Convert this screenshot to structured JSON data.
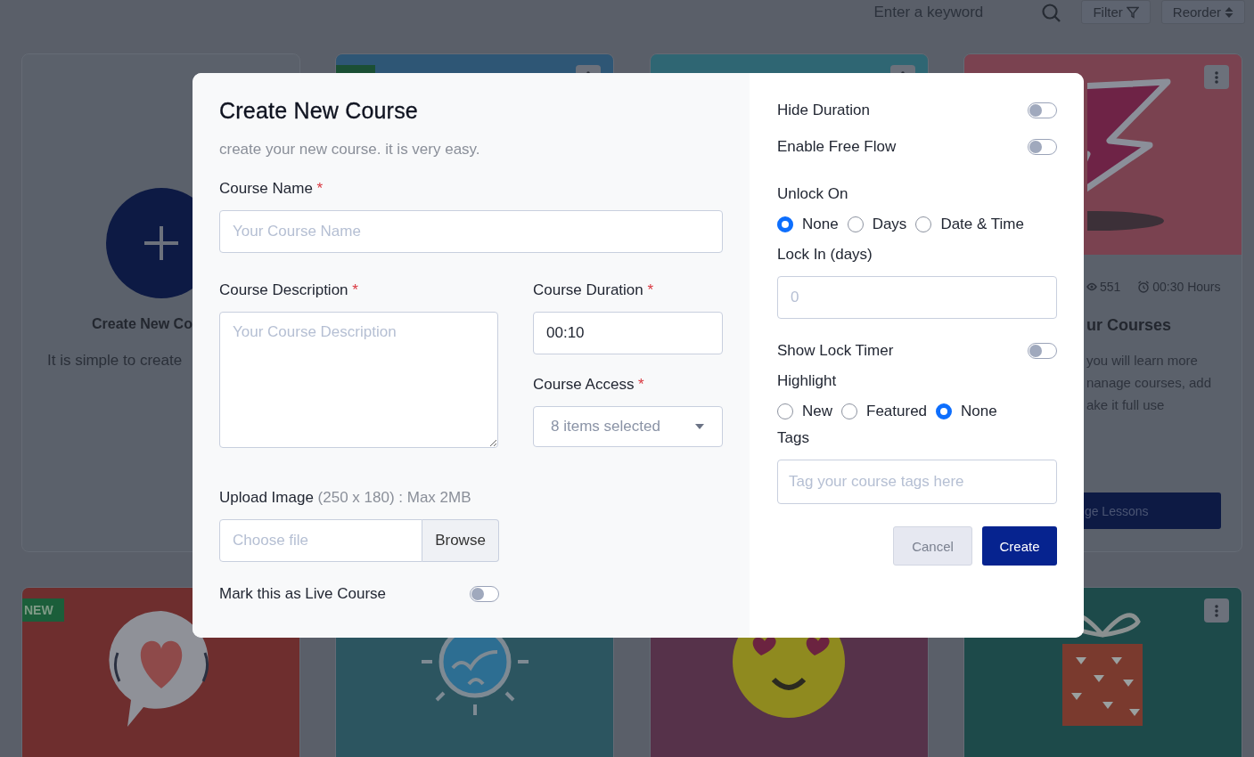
{
  "page": {
    "search": {
      "placeholder": "Enter a keyword"
    },
    "filter_button": "Filter",
    "reorder_button": "Reorder",
    "cards": [
      {
        "kind": "create",
        "title": "Create New Co",
        "text": "It is simple to create"
      },
      {
        "kind": "image",
        "color": "#2e5675",
        "flag": true,
        "menu": true
      },
      {
        "kind": "image",
        "color": "#2f6673",
        "menu": true
      },
      {
        "kind": "course",
        "color": "#7a4250",
        "menu": true,
        "views": "551",
        "duration": "00:30 Hours",
        "title": "ur Courses",
        "lines": [
          "you will learn more",
          "nanage courses, add",
          "ake it full use"
        ],
        "button": "ge Lessons"
      },
      {
        "kind": "image",
        "color": "#6e2e2e",
        "badge": "NEW",
        "menu": false
      },
      {
        "kind": "image",
        "color": "#2c5560",
        "menu": false
      },
      {
        "kind": "image",
        "color": "#56324a",
        "menu": false
      },
      {
        "kind": "image",
        "color": "#1d4a4a",
        "menu": true
      }
    ]
  },
  "modal": {
    "title": "Create New Course",
    "subtitle": "create your new course. it is very easy.",
    "course_name": {
      "label": "Course Name",
      "required_mark": "*",
      "placeholder": "Your Course Name"
    },
    "course_description": {
      "label": "Course Description",
      "required_mark": "*",
      "placeholder": "Your Course Description"
    },
    "course_duration": {
      "label": "Course Duration",
      "required_mark": "*",
      "value": "00:10"
    },
    "course_access": {
      "label": "Course Access",
      "required_mark": "*",
      "value": "8 items selected"
    },
    "upload_image": {
      "label": "Upload Image",
      "hint": "(250 x 180) : Max 2MB",
      "placeholder": "Choose file",
      "button": "Browse"
    },
    "live_course": {
      "label": "Mark this as Live Course",
      "on": false
    },
    "toggles": [
      {
        "label": "Hide Duration",
        "on": false
      },
      {
        "label": "Enable Free Flow",
        "on": false
      }
    ],
    "unlock_on": {
      "label": "Unlock On",
      "options": [
        {
          "label": "None",
          "selected": true
        },
        {
          "label": "Days",
          "selected": false
        },
        {
          "label": "Date & Time",
          "selected": false
        }
      ]
    },
    "lock_in": {
      "label": "Lock In (days)",
      "placeholder": "0"
    },
    "show_lock_timer": {
      "label": "Show Lock Timer",
      "on": false
    },
    "highlight": {
      "label": "Highlight",
      "options": [
        {
          "label": "New",
          "selected": false
        },
        {
          "label": "Featured",
          "selected": false
        },
        {
          "label": "None",
          "selected": true
        }
      ]
    },
    "tags": {
      "label": "Tags",
      "placeholder": "Tag your course tags here"
    },
    "cancel_button": "Cancel",
    "create_button": "Create"
  }
}
